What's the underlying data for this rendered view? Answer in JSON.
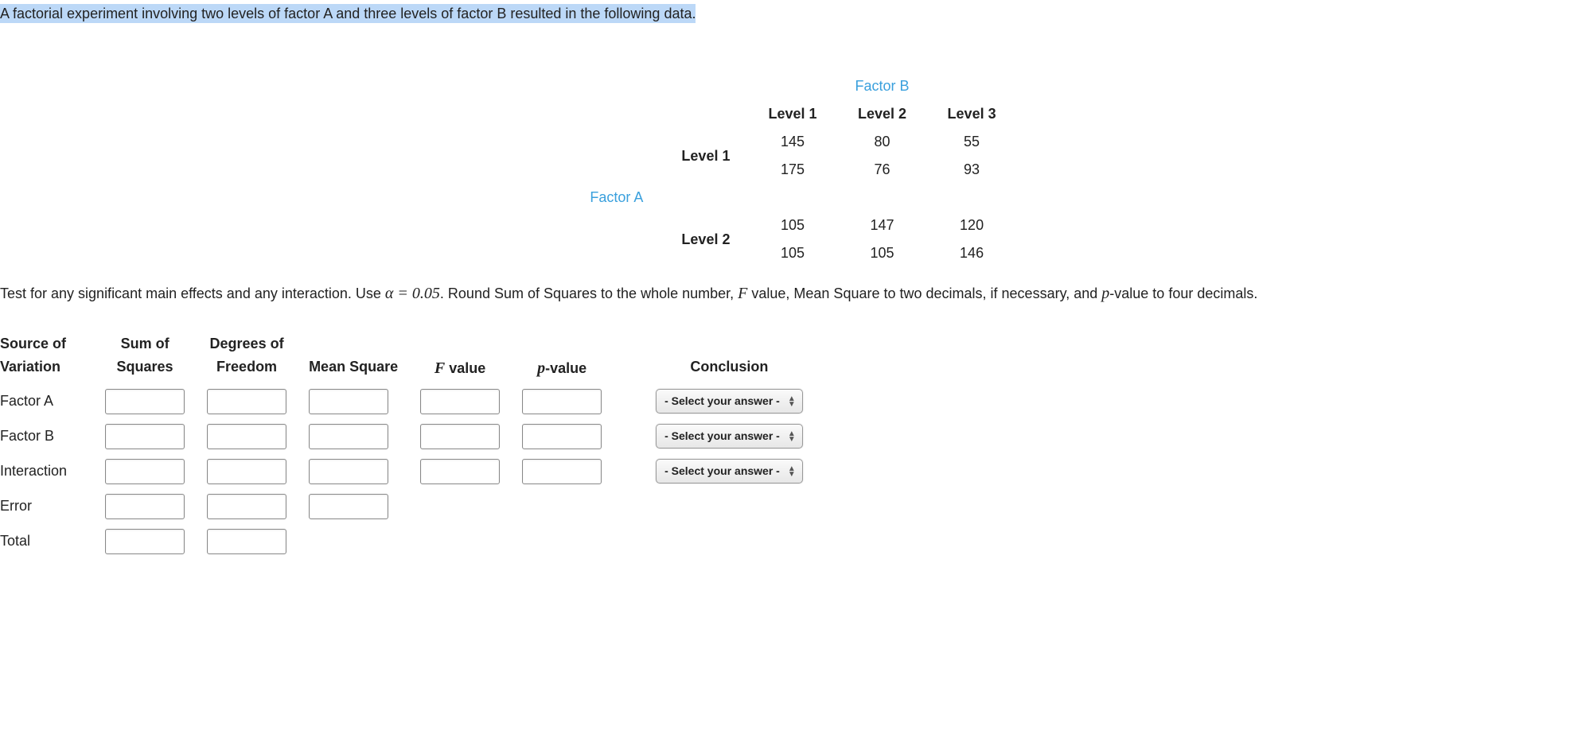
{
  "intro": "A factorial experiment involving two levels of factor A and three levels of factor B resulted in the following data.",
  "factorB_label": "Factor B",
  "factorA_label": "Factor A",
  "col_headers": {
    "l1": "Level 1",
    "l2": "Level 2",
    "l3": "Level 3"
  },
  "rowA1": "Level 1",
  "rowA2": "Level 2",
  "cells": {
    "a1": {
      "b1": [
        "145",
        "175"
      ],
      "b2": [
        "80",
        "76"
      ],
      "b3": [
        "55",
        "93"
      ]
    },
    "a2": {
      "b1": [
        "105",
        "105"
      ],
      "b2": [
        "147",
        "105"
      ],
      "b3": [
        "120",
        "146"
      ]
    }
  },
  "instructions": {
    "part1": "Test for any significant main effects and any interaction. Use ",
    "alpha_expr": "α = 0.05",
    "part2": ". Round Sum of Squares to the whole number, ",
    "F_sym": "F",
    "part3": " value, Mean Square to two decimals, if necessary, and ",
    "p_sym": "p",
    "part4": "-value to four decimals."
  },
  "anova_headers": {
    "src1": "Source of",
    "src2": "Variation",
    "ss1": "Sum of",
    "ss2": "Squares",
    "df1": "Degrees of",
    "df2": "Freedom",
    "ms": "Mean Square",
    "fv": "F value",
    "pv": "p-value",
    "conc": "Conclusion"
  },
  "pvalue_header_sym": "p",
  "fvalue_header_sym": "F",
  "rows": {
    "factorA": "Factor A",
    "factorB": "Factor B",
    "interaction": "Interaction",
    "error": "Error",
    "total": "Total"
  },
  "select_placeholder": "- Select your answer -"
}
